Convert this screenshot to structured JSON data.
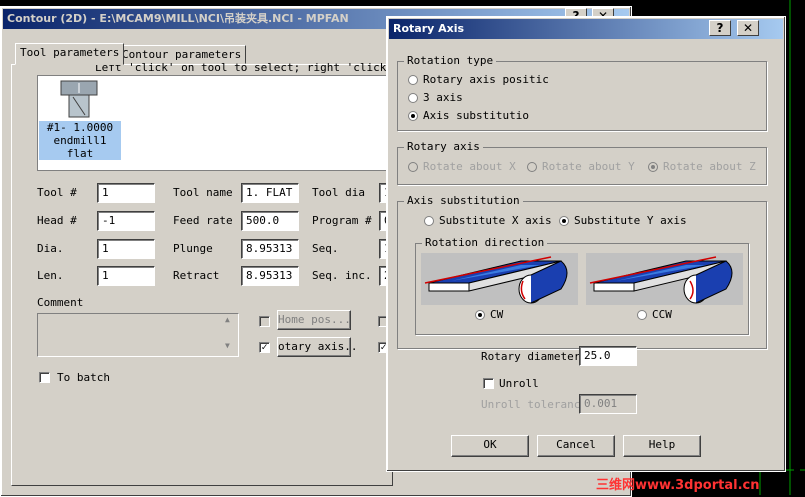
{
  "main_window": {
    "title": "Contour (2D) - E:\\MCAM9\\MILL\\NCI\\吊装夹具.NCI - MPFAN",
    "tabs": [
      "Tool parameters",
      "Contour parameters"
    ],
    "hint": "Left 'click' on tool to select; right 'click' to",
    "tool_item": {
      "line1": "#1- 1.0000",
      "line2": "endmill1 flat"
    },
    "fields": {
      "tool_num_label": "Tool #",
      "tool_num": "1",
      "head_num_label": "Head #",
      "head_num": "-1",
      "dia_label": "Dia.",
      "dia": "1",
      "len_label": "Len.",
      "len": "1",
      "tool_name_label": "Tool name",
      "tool_name": "1. FLAT",
      "feed_rate_label": "Feed rate",
      "feed_rate": "500.0",
      "plunge_label": "Plunge",
      "plunge": "8.95313",
      "retract_label": "Retract",
      "retract": "8.95313",
      "tool_dia_label": "Tool dia",
      "tool_dia": "1",
      "program_label": "Program #",
      "program": "0",
      "seq_label": "Seq.",
      "seq": "1",
      "seq_inc_label": "Seq. inc.",
      "seq_inc": "2"
    },
    "comment_label": "Comment",
    "home_pos_label": "Home pos...",
    "rotary_axis_label": "otary axis..",
    "to_batch_label": "To batch"
  },
  "dialog": {
    "title": "Rotary Axis",
    "help_btn": "?",
    "close_btn": "X",
    "rotation_type": {
      "title": "Rotation type",
      "options": [
        "Rotary axis positic",
        "3 axis",
        "Axis substitutio"
      ],
      "selected": 2
    },
    "rotary_axis": {
      "title": "Rotary axis",
      "options": [
        "Rotate about X ax",
        "Rotate about Y ax",
        "Rotate about Z ax"
      ]
    },
    "axis_substitution": {
      "title": "Axis substitution",
      "options": [
        "Substitute X axis",
        "Substitute Y axis"
      ],
      "selected": 1,
      "rotation_direction": {
        "title": "Rotation direction",
        "options": [
          "CW",
          "CCW"
        ],
        "selected": 0
      }
    },
    "rotary_diameter_label": "Rotary diameter",
    "rotary_diameter": "25.0",
    "unroll_label": "Unroll",
    "unroll_tolerance_label": "Unroll tolerance",
    "unroll_tolerance": "0.001",
    "ok": "OK",
    "cancel": "Cancel",
    "help": "Help"
  },
  "watermark": "三维网www.3dportal.cn",
  "colors": {
    "face": "#d4d0c8",
    "title_active": "#0a246a",
    "title_light": "#a6caf0",
    "watermark": "#ff3333",
    "bg": "#000000"
  }
}
